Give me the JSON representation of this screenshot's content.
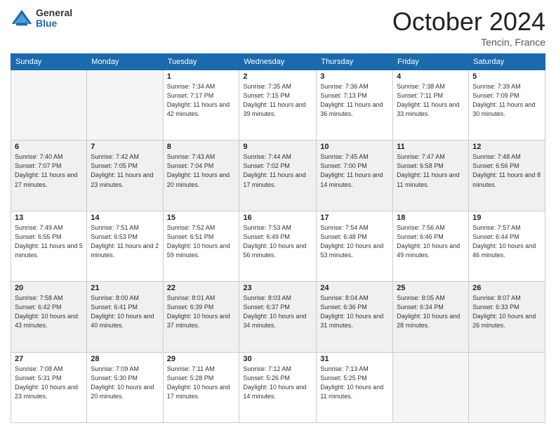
{
  "logo": {
    "general": "General",
    "blue": "Blue"
  },
  "header": {
    "month": "October 2024",
    "location": "Tencin, France"
  },
  "weekdays": [
    "Sunday",
    "Monday",
    "Tuesday",
    "Wednesday",
    "Thursday",
    "Friday",
    "Saturday"
  ],
  "weeks": [
    [
      {
        "day": "",
        "info": ""
      },
      {
        "day": "",
        "info": ""
      },
      {
        "day": "1",
        "info": "Sunrise: 7:34 AM\nSunset: 7:17 PM\nDaylight: 11 hours and 42 minutes."
      },
      {
        "day": "2",
        "info": "Sunrise: 7:35 AM\nSunset: 7:15 PM\nDaylight: 11 hours and 39 minutes."
      },
      {
        "day": "3",
        "info": "Sunrise: 7:36 AM\nSunset: 7:13 PM\nDaylight: 11 hours and 36 minutes."
      },
      {
        "day": "4",
        "info": "Sunrise: 7:38 AM\nSunset: 7:11 PM\nDaylight: 11 hours and 33 minutes."
      },
      {
        "day": "5",
        "info": "Sunrise: 7:39 AM\nSunset: 7:09 PM\nDaylight: 11 hours and 30 minutes."
      }
    ],
    [
      {
        "day": "6",
        "info": "Sunrise: 7:40 AM\nSunset: 7:07 PM\nDaylight: 11 hours and 27 minutes."
      },
      {
        "day": "7",
        "info": "Sunrise: 7:42 AM\nSunset: 7:05 PM\nDaylight: 11 hours and 23 minutes."
      },
      {
        "day": "8",
        "info": "Sunrise: 7:43 AM\nSunset: 7:04 PM\nDaylight: 11 hours and 20 minutes."
      },
      {
        "day": "9",
        "info": "Sunrise: 7:44 AM\nSunset: 7:02 PM\nDaylight: 11 hours and 17 minutes."
      },
      {
        "day": "10",
        "info": "Sunrise: 7:45 AM\nSunset: 7:00 PM\nDaylight: 11 hours and 14 minutes."
      },
      {
        "day": "11",
        "info": "Sunrise: 7:47 AM\nSunset: 6:58 PM\nDaylight: 11 hours and 11 minutes."
      },
      {
        "day": "12",
        "info": "Sunrise: 7:48 AM\nSunset: 6:56 PM\nDaylight: 11 hours and 8 minutes."
      }
    ],
    [
      {
        "day": "13",
        "info": "Sunrise: 7:49 AM\nSunset: 6:55 PM\nDaylight: 11 hours and 5 minutes."
      },
      {
        "day": "14",
        "info": "Sunrise: 7:51 AM\nSunset: 6:53 PM\nDaylight: 11 hours and 2 minutes."
      },
      {
        "day": "15",
        "info": "Sunrise: 7:52 AM\nSunset: 6:51 PM\nDaylight: 10 hours and 59 minutes."
      },
      {
        "day": "16",
        "info": "Sunrise: 7:53 AM\nSunset: 6:49 PM\nDaylight: 10 hours and 56 minutes."
      },
      {
        "day": "17",
        "info": "Sunrise: 7:54 AM\nSunset: 6:48 PM\nDaylight: 10 hours and 53 minutes."
      },
      {
        "day": "18",
        "info": "Sunrise: 7:56 AM\nSunset: 6:46 PM\nDaylight: 10 hours and 49 minutes."
      },
      {
        "day": "19",
        "info": "Sunrise: 7:57 AM\nSunset: 6:44 PM\nDaylight: 10 hours and 46 minutes."
      }
    ],
    [
      {
        "day": "20",
        "info": "Sunrise: 7:58 AM\nSunset: 6:42 PM\nDaylight: 10 hours and 43 minutes."
      },
      {
        "day": "21",
        "info": "Sunrise: 8:00 AM\nSunset: 6:41 PM\nDaylight: 10 hours and 40 minutes."
      },
      {
        "day": "22",
        "info": "Sunrise: 8:01 AM\nSunset: 6:39 PM\nDaylight: 10 hours and 37 minutes."
      },
      {
        "day": "23",
        "info": "Sunrise: 8:03 AM\nSunset: 6:37 PM\nDaylight: 10 hours and 34 minutes."
      },
      {
        "day": "24",
        "info": "Sunrise: 8:04 AM\nSunset: 6:36 PM\nDaylight: 10 hours and 31 minutes."
      },
      {
        "day": "25",
        "info": "Sunrise: 8:05 AM\nSunset: 6:34 PM\nDaylight: 10 hours and 28 minutes."
      },
      {
        "day": "26",
        "info": "Sunrise: 8:07 AM\nSunset: 6:33 PM\nDaylight: 10 hours and 26 minutes."
      }
    ],
    [
      {
        "day": "27",
        "info": "Sunrise: 7:08 AM\nSunset: 5:31 PM\nDaylight: 10 hours and 23 minutes."
      },
      {
        "day": "28",
        "info": "Sunrise: 7:09 AM\nSunset: 5:30 PM\nDaylight: 10 hours and 20 minutes."
      },
      {
        "day": "29",
        "info": "Sunrise: 7:11 AM\nSunset: 5:28 PM\nDaylight: 10 hours and 17 minutes."
      },
      {
        "day": "30",
        "info": "Sunrise: 7:12 AM\nSunset: 5:26 PM\nDaylight: 10 hours and 14 minutes."
      },
      {
        "day": "31",
        "info": "Sunrise: 7:13 AM\nSunset: 5:25 PM\nDaylight: 10 hours and 11 minutes."
      },
      {
        "day": "",
        "info": ""
      },
      {
        "day": "",
        "info": ""
      }
    ]
  ]
}
